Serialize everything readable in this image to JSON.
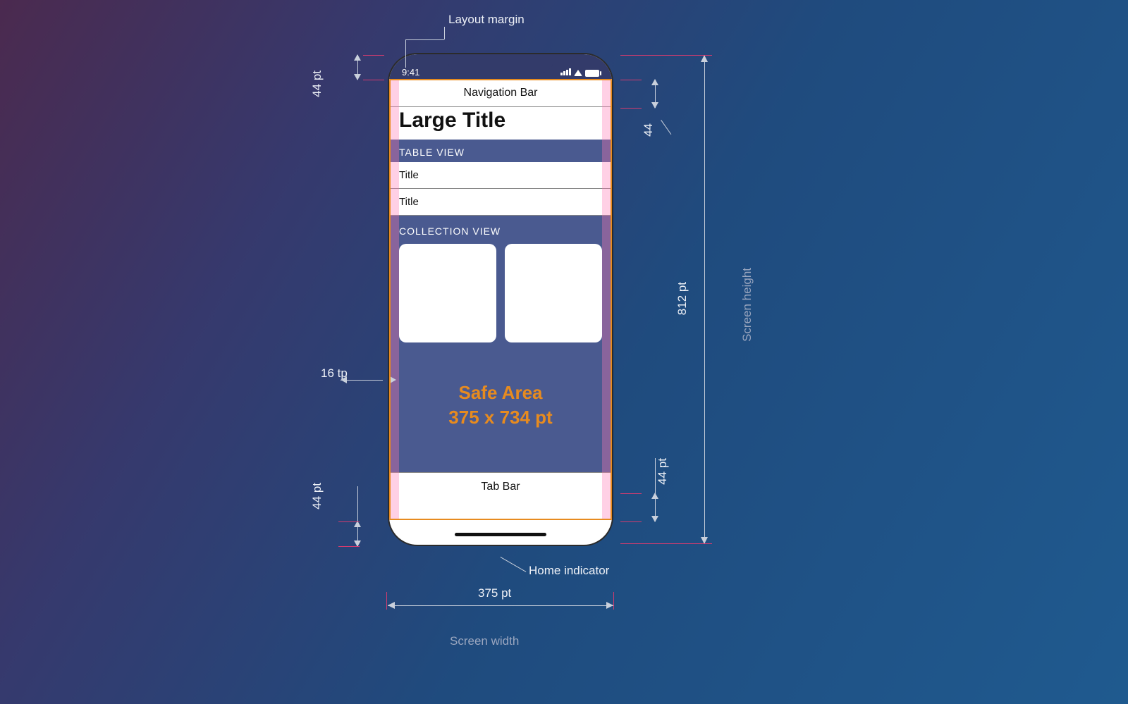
{
  "callouts": {
    "layout_margin": "Layout margin",
    "home_indicator": "Home indicator",
    "screen_width": "Screen width",
    "screen_height": "Screen height"
  },
  "dims": {
    "status_bar_pt": "44 pt",
    "nav_bar_pt": "44",
    "tab_bar_pt": "44 pt",
    "home_ind_pt": "44 pt",
    "side_margin": "16 tp",
    "width_pt": "375 pt",
    "height_pt": "812 pt"
  },
  "phone": {
    "time": "9:41",
    "navbar": "Navigation Bar",
    "large_title": "Large Title",
    "tableview_header": "TABLE VIEW",
    "cell1": "Title",
    "cell2": "Title",
    "collection_header": "COLLECTION VIEW",
    "safe_area_line1": "Safe Area",
    "safe_area_line2": "375 x 734 pt",
    "tabbar": "Tab Bar"
  }
}
